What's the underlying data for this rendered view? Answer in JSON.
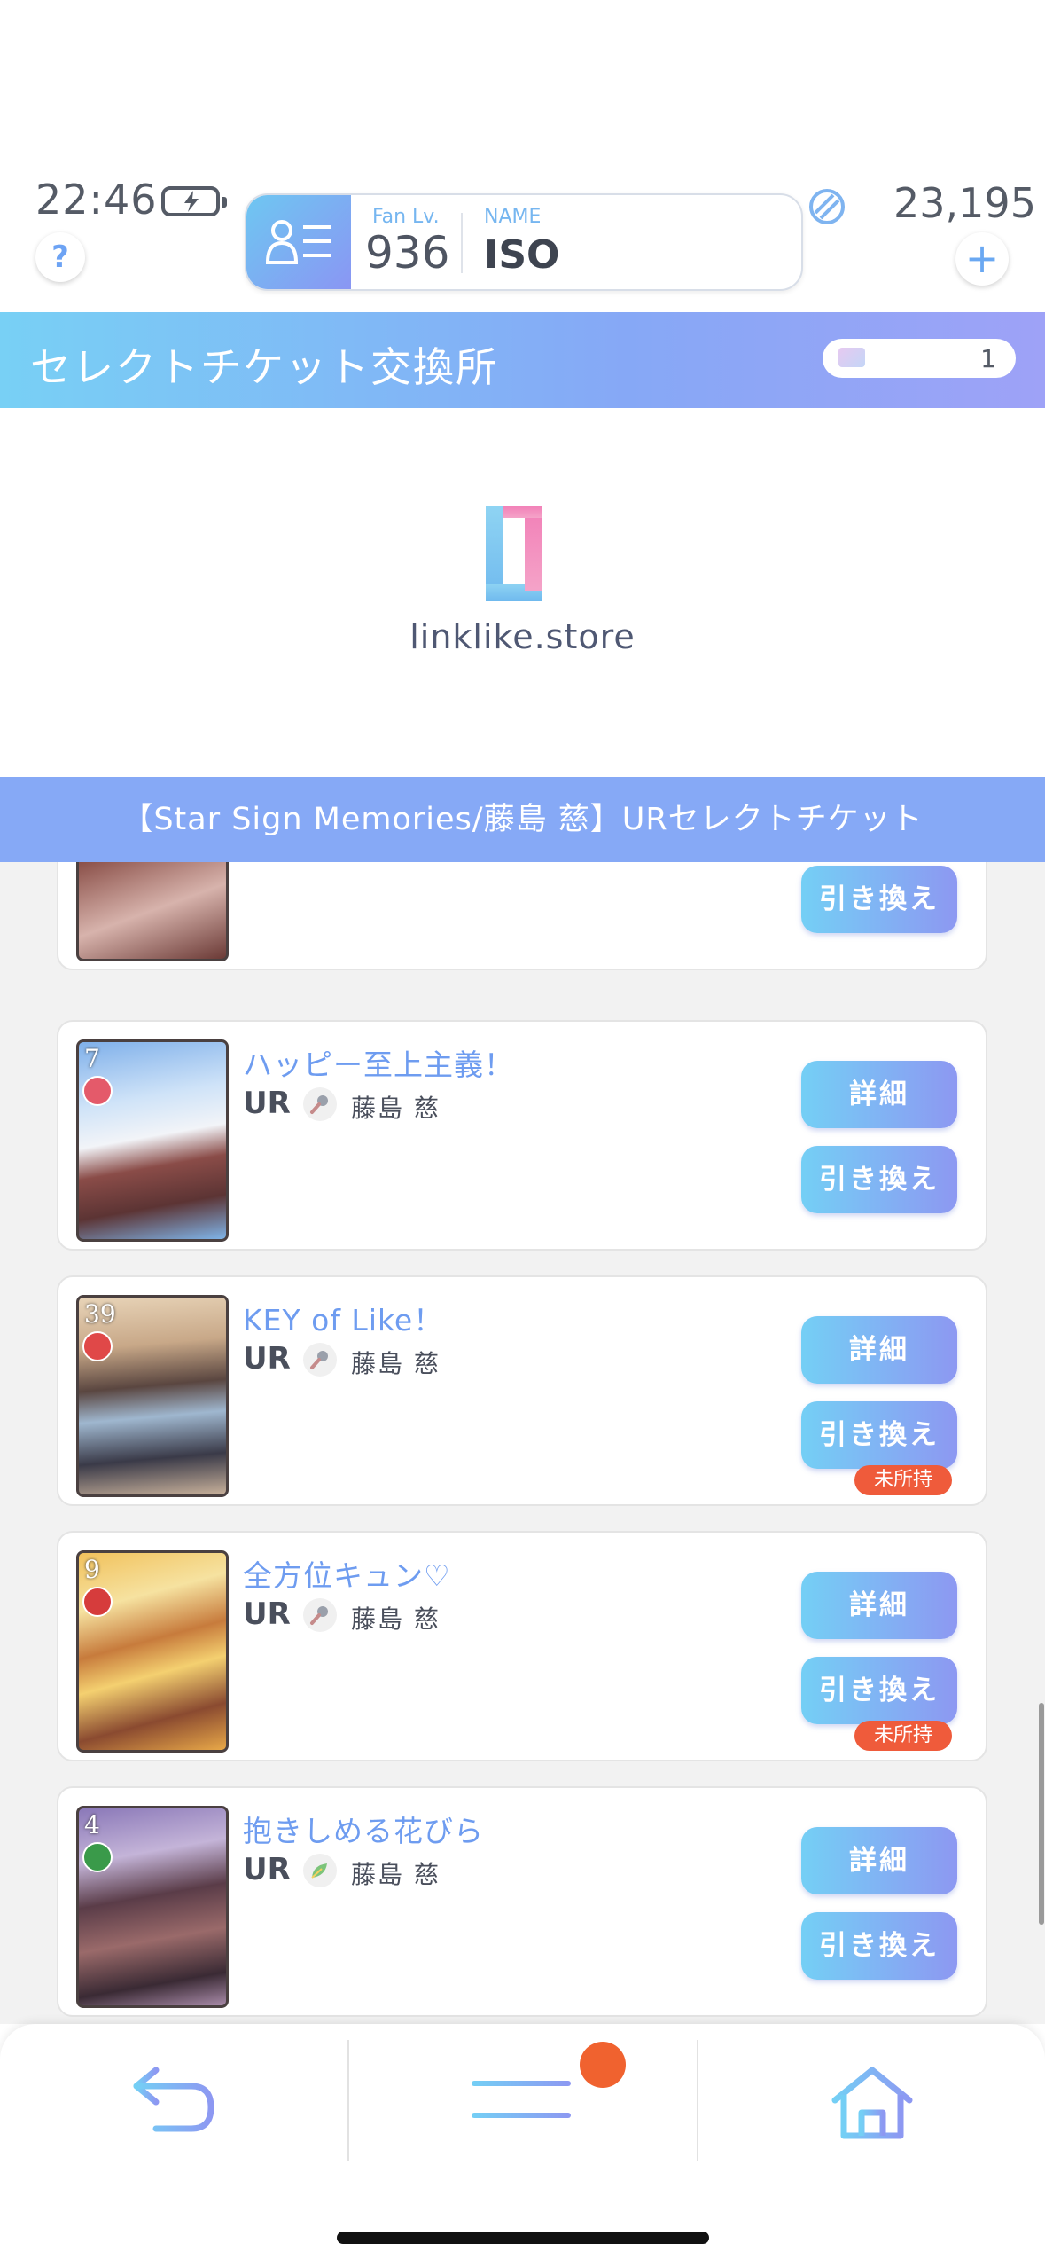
{
  "status": {
    "time": "22:46"
  },
  "header": {
    "help_label": "?",
    "fan_lv_label": "Fan Lv.",
    "fan_lv_value": "936",
    "name_label": "NAME",
    "name_value": "ISO",
    "currency_value": "23,195",
    "plus_label": "+"
  },
  "title_bar": {
    "title": "セレクトチケット交換所",
    "ticket_count": "1"
  },
  "banner": {
    "logo_text": "linklike.store"
  },
  "ticket_bar": {
    "title": "【Star Sign Memories/藤島 慈】URセレクトチケット"
  },
  "buttons": {
    "detail": "詳細",
    "exchange": "引き換え",
    "unowned": "未所持"
  },
  "cards": [
    {
      "name": "",
      "rarity": "",
      "member": "",
      "num": ""
    },
    {
      "name": "ハッピー至上主義！",
      "rarity": "UR",
      "member": "藤島 慈",
      "num": "7",
      "attr": "mic-icon",
      "owned": true
    },
    {
      "name": "KEY of Like！",
      "rarity": "UR",
      "member": "藤島 慈",
      "num": "39",
      "attr": "mic-icon",
      "owned": false
    },
    {
      "name": "全方位キュン♡",
      "rarity": "UR",
      "member": "藤島 慈",
      "num": "9",
      "attr": "mic-icon",
      "owned": false
    },
    {
      "name": "抱きしめる花びら",
      "rarity": "UR",
      "member": "藤島 慈",
      "num": "4",
      "attr": "leaf-icon",
      "owned": true
    }
  ],
  "colors": {
    "accent": "#86a9f6",
    "button_gradient_start": "#74cff5",
    "button_gradient_end": "#8d98f2",
    "name_text": "#6e9cf0",
    "unowned_badge": "#ef5b3b",
    "notification_dot": "#f0622f"
  }
}
